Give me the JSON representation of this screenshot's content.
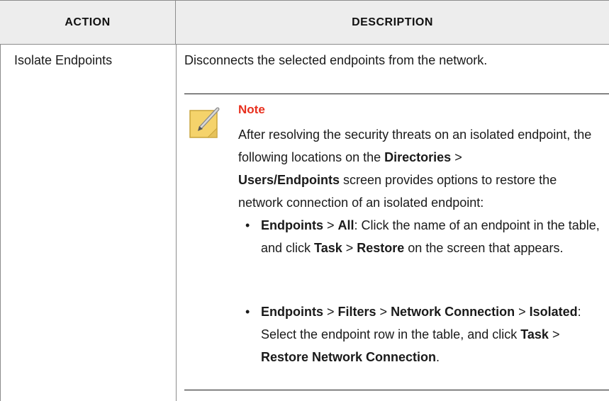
{
  "header": {
    "action": "ACTION",
    "description": "DESCRIPTION"
  },
  "row": {
    "action": "Isolate Endpoints",
    "description": "Disconnects the selected endpoints from the network."
  },
  "note": {
    "icon": "note-pencil-icon",
    "title": "Note",
    "body_1": "After resolving the security threats on an isolated endpoint, the following locations on the ",
    "b_directories": "Directories",
    "sep1": " > ",
    "b_users": "Users/Endpoints",
    "body_2": " screen provides options to restore the network connection of an isolated endpoint:"
  },
  "bullets": [
    {
      "b1": "Endpoints",
      "s1": " > ",
      "b2": "All",
      "t1": ": Click the name of an endpoint in the table, and click ",
      "b3": "Task",
      "s2": " > ",
      "b4": "Restore",
      "t2": " on the screen that appears."
    },
    {
      "b1": "Endpoints",
      "s1": " > ",
      "b2": "Filters",
      "s2": " > ",
      "b3": "Network Connection",
      "s3": " > ",
      "b4": "Isolated",
      "t1": ": Select the endpoint row in the table, and click ",
      "b5": "Task",
      "s4": " > ",
      "b6": "Restore Network Connection",
      "t2": "."
    }
  ],
  "colors": {
    "header_bg": "#ededed",
    "note_title": "#e8301e",
    "note_icon": "#f5d36b"
  }
}
